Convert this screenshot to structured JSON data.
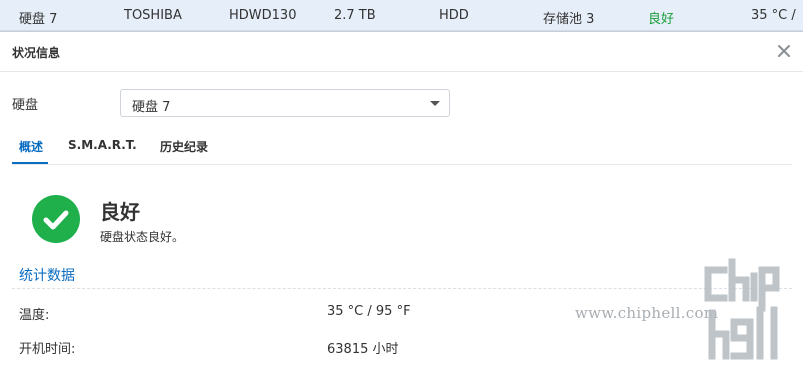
{
  "background_row": {
    "name": "硬盘 7",
    "brand": "TOSHIBA",
    "model": "HDWD130",
    "capacity": "2.7 TB",
    "type": "HDD",
    "pool": "存储池 3",
    "status": "良好",
    "temperature": "35 °C /",
    "status_color": "#1a9e3a"
  },
  "dialog": {
    "title": "状况信息",
    "close_icon": "close-icon",
    "disk_label": "硬盘",
    "disk_select_value": "硬盘 7",
    "tabs": [
      {
        "label": "概述",
        "active": true
      },
      {
        "label": "S.M.A.R.T.",
        "active": false
      },
      {
        "label": "历史纪录",
        "active": false
      }
    ],
    "status": {
      "icon": "check-circle-icon",
      "icon_color": "#1fb04c",
      "title": "良好",
      "description": "硬盘状态良好。"
    },
    "stats": {
      "section_title": "统计数据",
      "rows": [
        {
          "label": "温度:",
          "value": "35 °C / 95 °F"
        },
        {
          "label": "开机时间:",
          "value": "63815 小时"
        }
      ]
    }
  },
  "watermark": {
    "url": "www.chiphell.com",
    "logo_text": "chip hell"
  },
  "colors": {
    "accent": "#0a6dc2",
    "row_highlight": "#e6eef9"
  }
}
